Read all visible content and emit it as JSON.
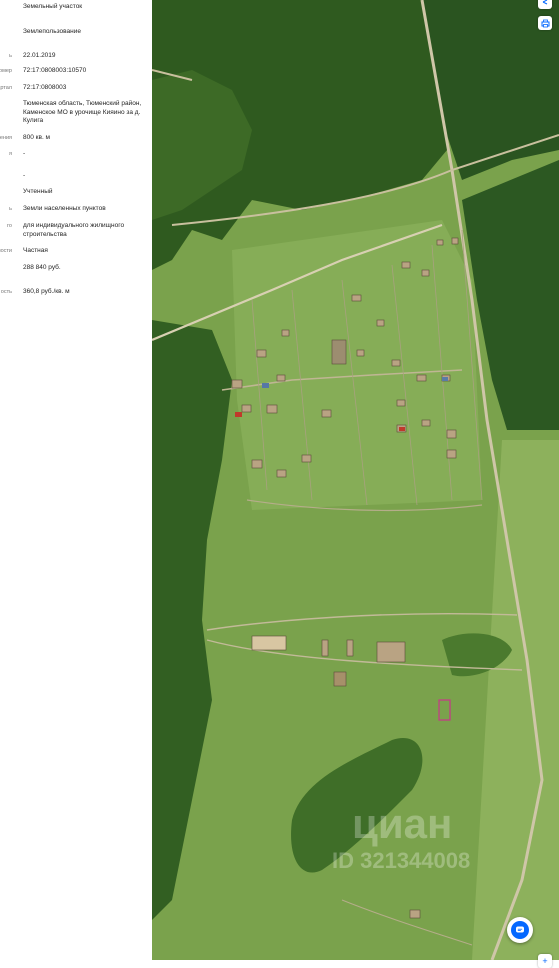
{
  "listing": {
    "rows": [
      {
        "label": "",
        "value": "Земельный участок"
      },
      {
        "label": "",
        "value": "Землепользование"
      },
      {
        "label": "ь",
        "value": "22.01.2019"
      },
      {
        "label": "омер",
        "value": "72:17:0808003:10570"
      },
      {
        "label": "артал",
        "value": "72:17:0808003"
      },
      {
        "label": "",
        "value": "Тюменская область, Тюменский район, Каменское МО в урочище Кияино за д. Кулига"
      },
      {
        "label": "ения",
        "value": "800 кв. м"
      },
      {
        "label": "я",
        "value": "-"
      },
      {
        "label": "",
        "value": "-"
      },
      {
        "label": "",
        "value": "Учтенный"
      },
      {
        "label": "ь",
        "value": "Земли населенных пунктов"
      },
      {
        "label": "го",
        "value": "для индивидуального жилищного строительства"
      },
      {
        "label": "ности",
        "value": "Частная"
      },
      {
        "label": "",
        "value": "288 840 руб."
      },
      {
        "label": "ость",
        "value": "360,8 руб./кв. м"
      }
    ]
  },
  "watermark": {
    "brand": "циан",
    "id_text": "ID 321344008"
  },
  "controls": {
    "top_icon": "share-icon",
    "print_icon": "printer-icon",
    "chat_icon": "chat-bubble-icon",
    "bottom_icon": "plus-icon"
  },
  "colors": {
    "forest": "#2f5a1f",
    "field": "#7aa24c",
    "road": "#cfc6a8",
    "chat_blue": "#0468ff",
    "plot_outline": "#c9368a"
  }
}
